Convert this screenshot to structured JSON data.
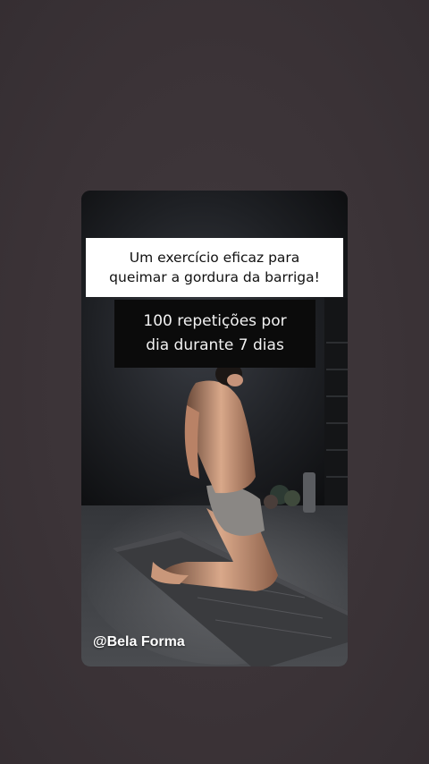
{
  "story": {
    "caption_top": "Um exercício eficaz para\nqueimar a gordura da barriga!",
    "caption_bottom": "100 repetições por\ndia durante 7 dias",
    "watermark": "@Bela Forma"
  },
  "colors": {
    "page_background": "#3a3236",
    "caption_top_bg": "#ffffff",
    "caption_bottom_bg": "#0b0b0b"
  }
}
